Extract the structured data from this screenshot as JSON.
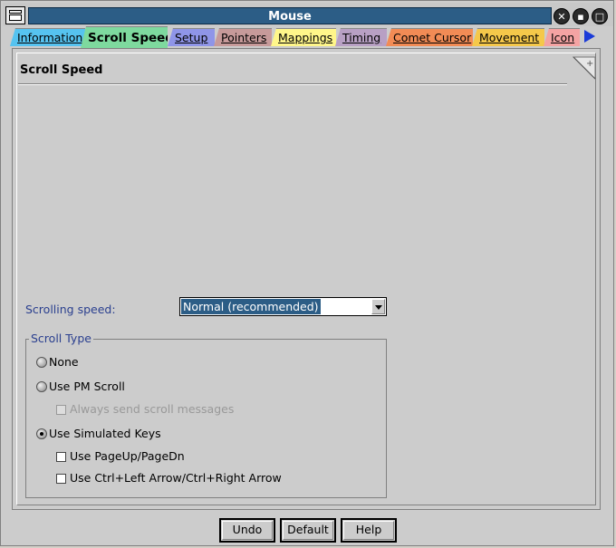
{
  "window": {
    "title": "Mouse"
  },
  "tabs": [
    {
      "label": "Information",
      "color": "#56c3f0"
    },
    {
      "label": "Scroll Speed",
      "color": "#7ed99e"
    },
    {
      "label": "Setup",
      "color": "#8f95e8"
    },
    {
      "label": "Pointers",
      "color": "#c79a9a"
    },
    {
      "label": "Mappings",
      "color": "#fff68a"
    },
    {
      "label": "Timing",
      "color": "#b8a0c4"
    },
    {
      "label": "Comet Cursor",
      "color": "#f28b55"
    },
    {
      "label": "Movement",
      "color": "#f5c84a"
    },
    {
      "label": "Icon",
      "color": "#f4a3a3"
    }
  ],
  "page": {
    "title": "Scroll Speed",
    "scrolling_speed_label": "Scrolling speed:",
    "scrolling_speed_value": "Normal (recommended)"
  },
  "scroll_type": {
    "title": "Scroll Type",
    "none": "None",
    "use_pm_scroll": "Use PM Scroll",
    "always_send": "Always send scroll messages",
    "use_simulated_keys": "Use Simulated Keys",
    "use_pageup_pagedn": "Use PageUp/PageDn",
    "use_ctrl_arrows": "Use Ctrl+Left Arrow/Ctrl+Right Arrow",
    "selected": "use_simulated_keys"
  },
  "buttons": {
    "undo": "Undo",
    "default": "Default",
    "help": "Help"
  }
}
